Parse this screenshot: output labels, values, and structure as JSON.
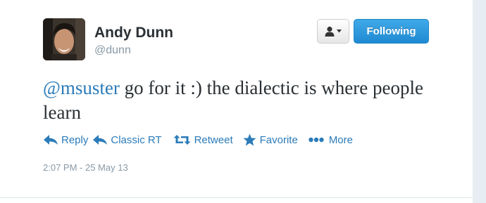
{
  "user": {
    "name": "Andy Dunn",
    "handle": "@dunn"
  },
  "buttons": {
    "follow_label": "Following",
    "user_menu_icon": "person-dropdown-icon"
  },
  "tweet": {
    "mention": "@msuster",
    "text": " go for it :) the dialectic is where people learn",
    "timestamp": "2:07 PM - 25 May 13"
  },
  "actions": {
    "reply": "Reply",
    "classic_rt": "Classic RT",
    "retweet": "Retweet",
    "favorite": "Favorite",
    "more": "More"
  },
  "colors": {
    "link": "#2b7bb9",
    "follow_button": "#2b8fd6",
    "text": "#292f33",
    "muted": "#8899a6"
  }
}
